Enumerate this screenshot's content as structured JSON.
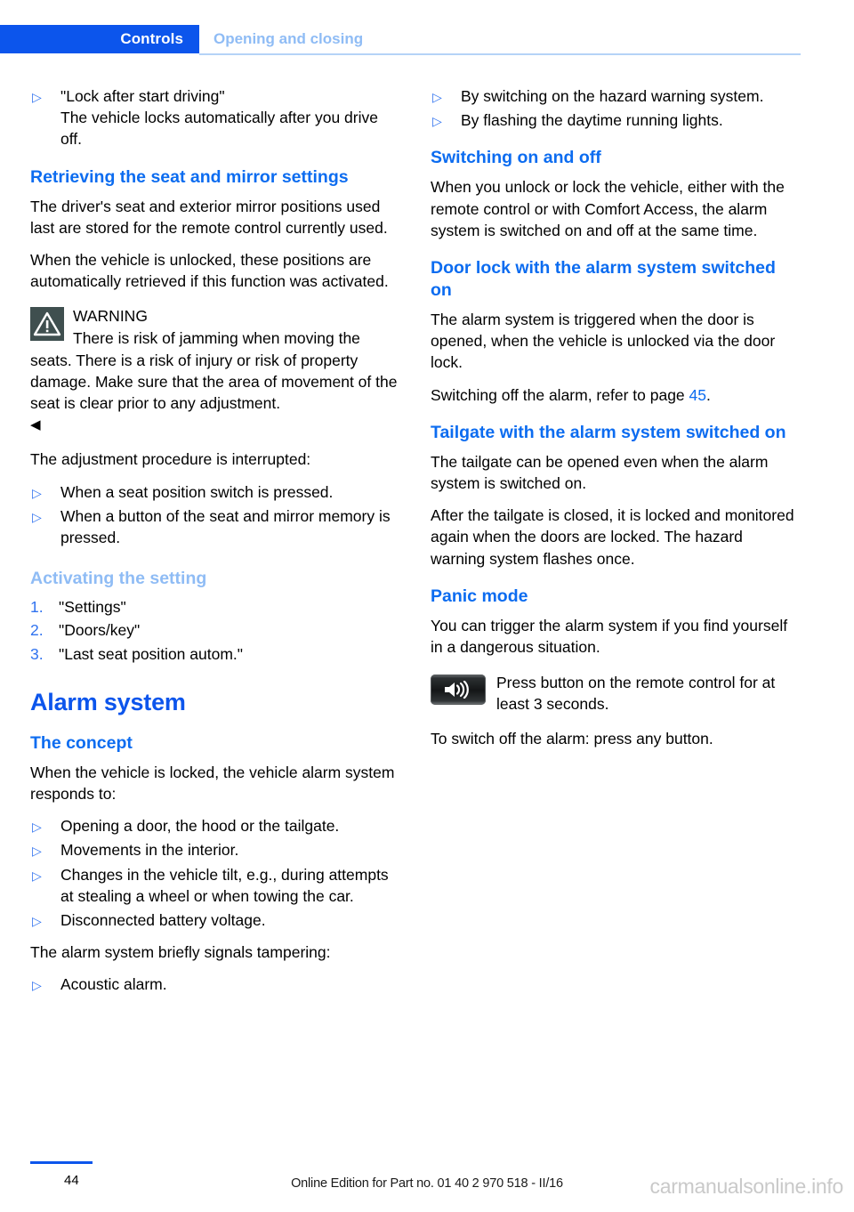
{
  "header": {
    "tab_label": "Controls",
    "section_label": "Opening and closing",
    "tab_color": "#0c55ec",
    "section_color": "#8fbcf5"
  },
  "left_column": {
    "intro_bullets": [
      {
        "marker": "▷",
        "text": "\"Lock after start driving\""
      }
    ],
    "intro_sub_text": "The vehicle locks automatically after you drive off.",
    "retrieving_heading": "Retrieving the seat and mirror settings",
    "retrieving_p1": "The driver's seat and exterior mirror positions used last are stored for the remote control currently used.",
    "retrieving_p2": "When the vehicle is unlocked, these positions are automatically retrieved if this function was activated.",
    "warning": {
      "icon": "warning-triangle-icon",
      "title": "WARNING",
      "text": "There is risk of jamming when moving the seats. There is a risk of injury or risk of property damage. Make sure that the area of movement of the seat is clear prior to any adjustment.",
      "end_marker": "◀",
      "icon_bg": "#3f4f4f"
    },
    "interrupt_intro": "The adjustment procedure is interrupted:",
    "interrupt_bullets": [
      {
        "marker": "▷",
        "text": "When a seat position switch is pressed."
      },
      {
        "marker": "▷",
        "text": "When a button of the seat and mirror memory is pressed."
      }
    ],
    "activating_heading": "Activating the setting",
    "activating_steps": [
      {
        "marker": "1.",
        "text": "\"Settings\""
      },
      {
        "marker": "2.",
        "text": "\"Doors/key\""
      },
      {
        "marker": "3.",
        "text": "\"Last seat position autom.\""
      }
    ],
    "alarm_heading": "Alarm system",
    "concept_heading": "The concept",
    "concept_intro": "When the vehicle is locked, the vehicle alarm system responds to:",
    "concept_bullets": [
      {
        "marker": "▷",
        "text": "Opening a door, the hood or the tailgate."
      },
      {
        "marker": "▷",
        "text": "Movements in the interior."
      },
      {
        "marker": "▷",
        "text": "Changes in the vehicle tilt, e.g., during attempts at stealing a wheel or when towing the car."
      },
      {
        "marker": "▷",
        "text": "Disconnected battery voltage."
      }
    ],
    "tampering_intro": "The alarm system briefly signals tampering:",
    "tampering_bullets": [
      {
        "marker": "▷",
        "text": "Acoustic alarm."
      }
    ]
  },
  "right_column": {
    "top_bullets": [
      {
        "marker": "▷",
        "text": "By switching on the hazard warning system."
      },
      {
        "marker": "▷",
        "text": "By flashing the daytime running lights."
      }
    ],
    "switching_heading": "Switching on and off",
    "switching_text": "When you unlock or lock the vehicle, either with the remote control or with Comfort Access, the alarm system is switched on and off at the same time.",
    "doorlock_heading": "Door lock with the alarm system switched on",
    "doorlock_p1": "The alarm system is triggered when the door is opened, when the vehicle is unlocked via the door lock.",
    "doorlock_p2_pre": "Switching off the alarm, refer to page ",
    "doorlock_p2_ref": "45",
    "doorlock_p2_post": ".",
    "tailgate_heading": "Tailgate with the alarm system switched on",
    "tailgate_p1": "The tailgate can be opened even when the alarm system is switched on.",
    "tailgate_p2": "After the tailgate is closed, it is locked and monitored again when the doors are locked. The hazard warning system flashes once.",
    "panic_heading": "Panic mode",
    "panic_p1": "You can trigger the alarm system if you find yourself in a dangerous situation.",
    "remote": {
      "icon": "speaker-sound-icon",
      "text": "Press button on the remote control for at least 3 seconds."
    },
    "panic_p2": "To switch off the alarm: press any button."
  },
  "footer": {
    "page_number": "44",
    "edition_text": "Online Edition for Part no. 01 40 2 970 518 - II/16",
    "watermark": "carmanualsonline.info"
  }
}
